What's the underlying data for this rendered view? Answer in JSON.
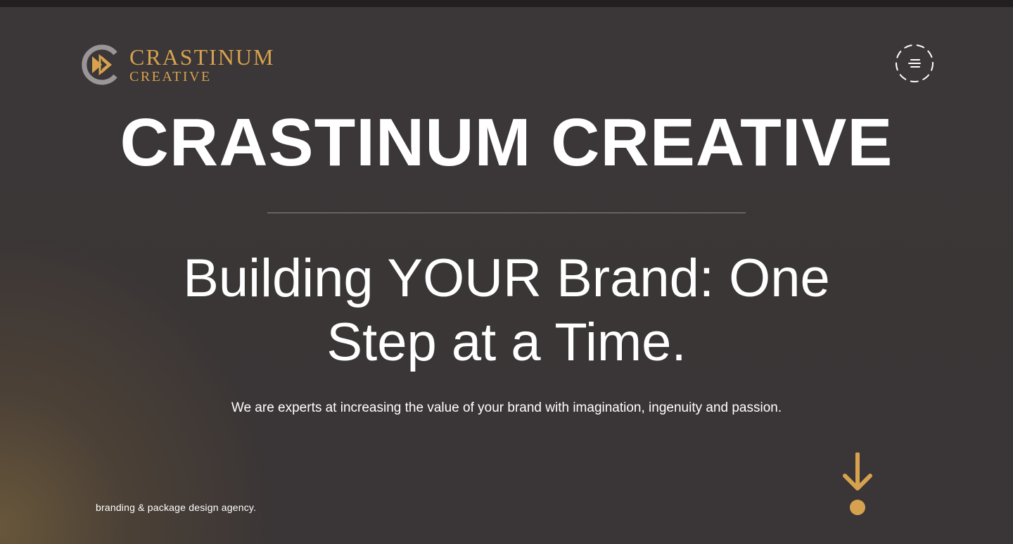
{
  "header": {
    "logo": {
      "name": "CRASTINUM",
      "subname": "CREATIVE",
      "icon": "play-forward-logo-icon"
    },
    "menu_button": {
      "icon": "menu-icon"
    }
  },
  "hero": {
    "title": "CRASTINUM CREATIVE",
    "subtitle": "Building YOUR Brand: One Step at a Time.",
    "description": "We are experts at increasing the value of your brand with imagination, ingenuity and passion.",
    "tagline": "branding & package design agency.",
    "scroll_icon": "arrow-down-icon"
  },
  "colors": {
    "accent": "#d6a24f",
    "background": "#3a3536",
    "topbar": "#231f20",
    "text": "#ffffff"
  }
}
